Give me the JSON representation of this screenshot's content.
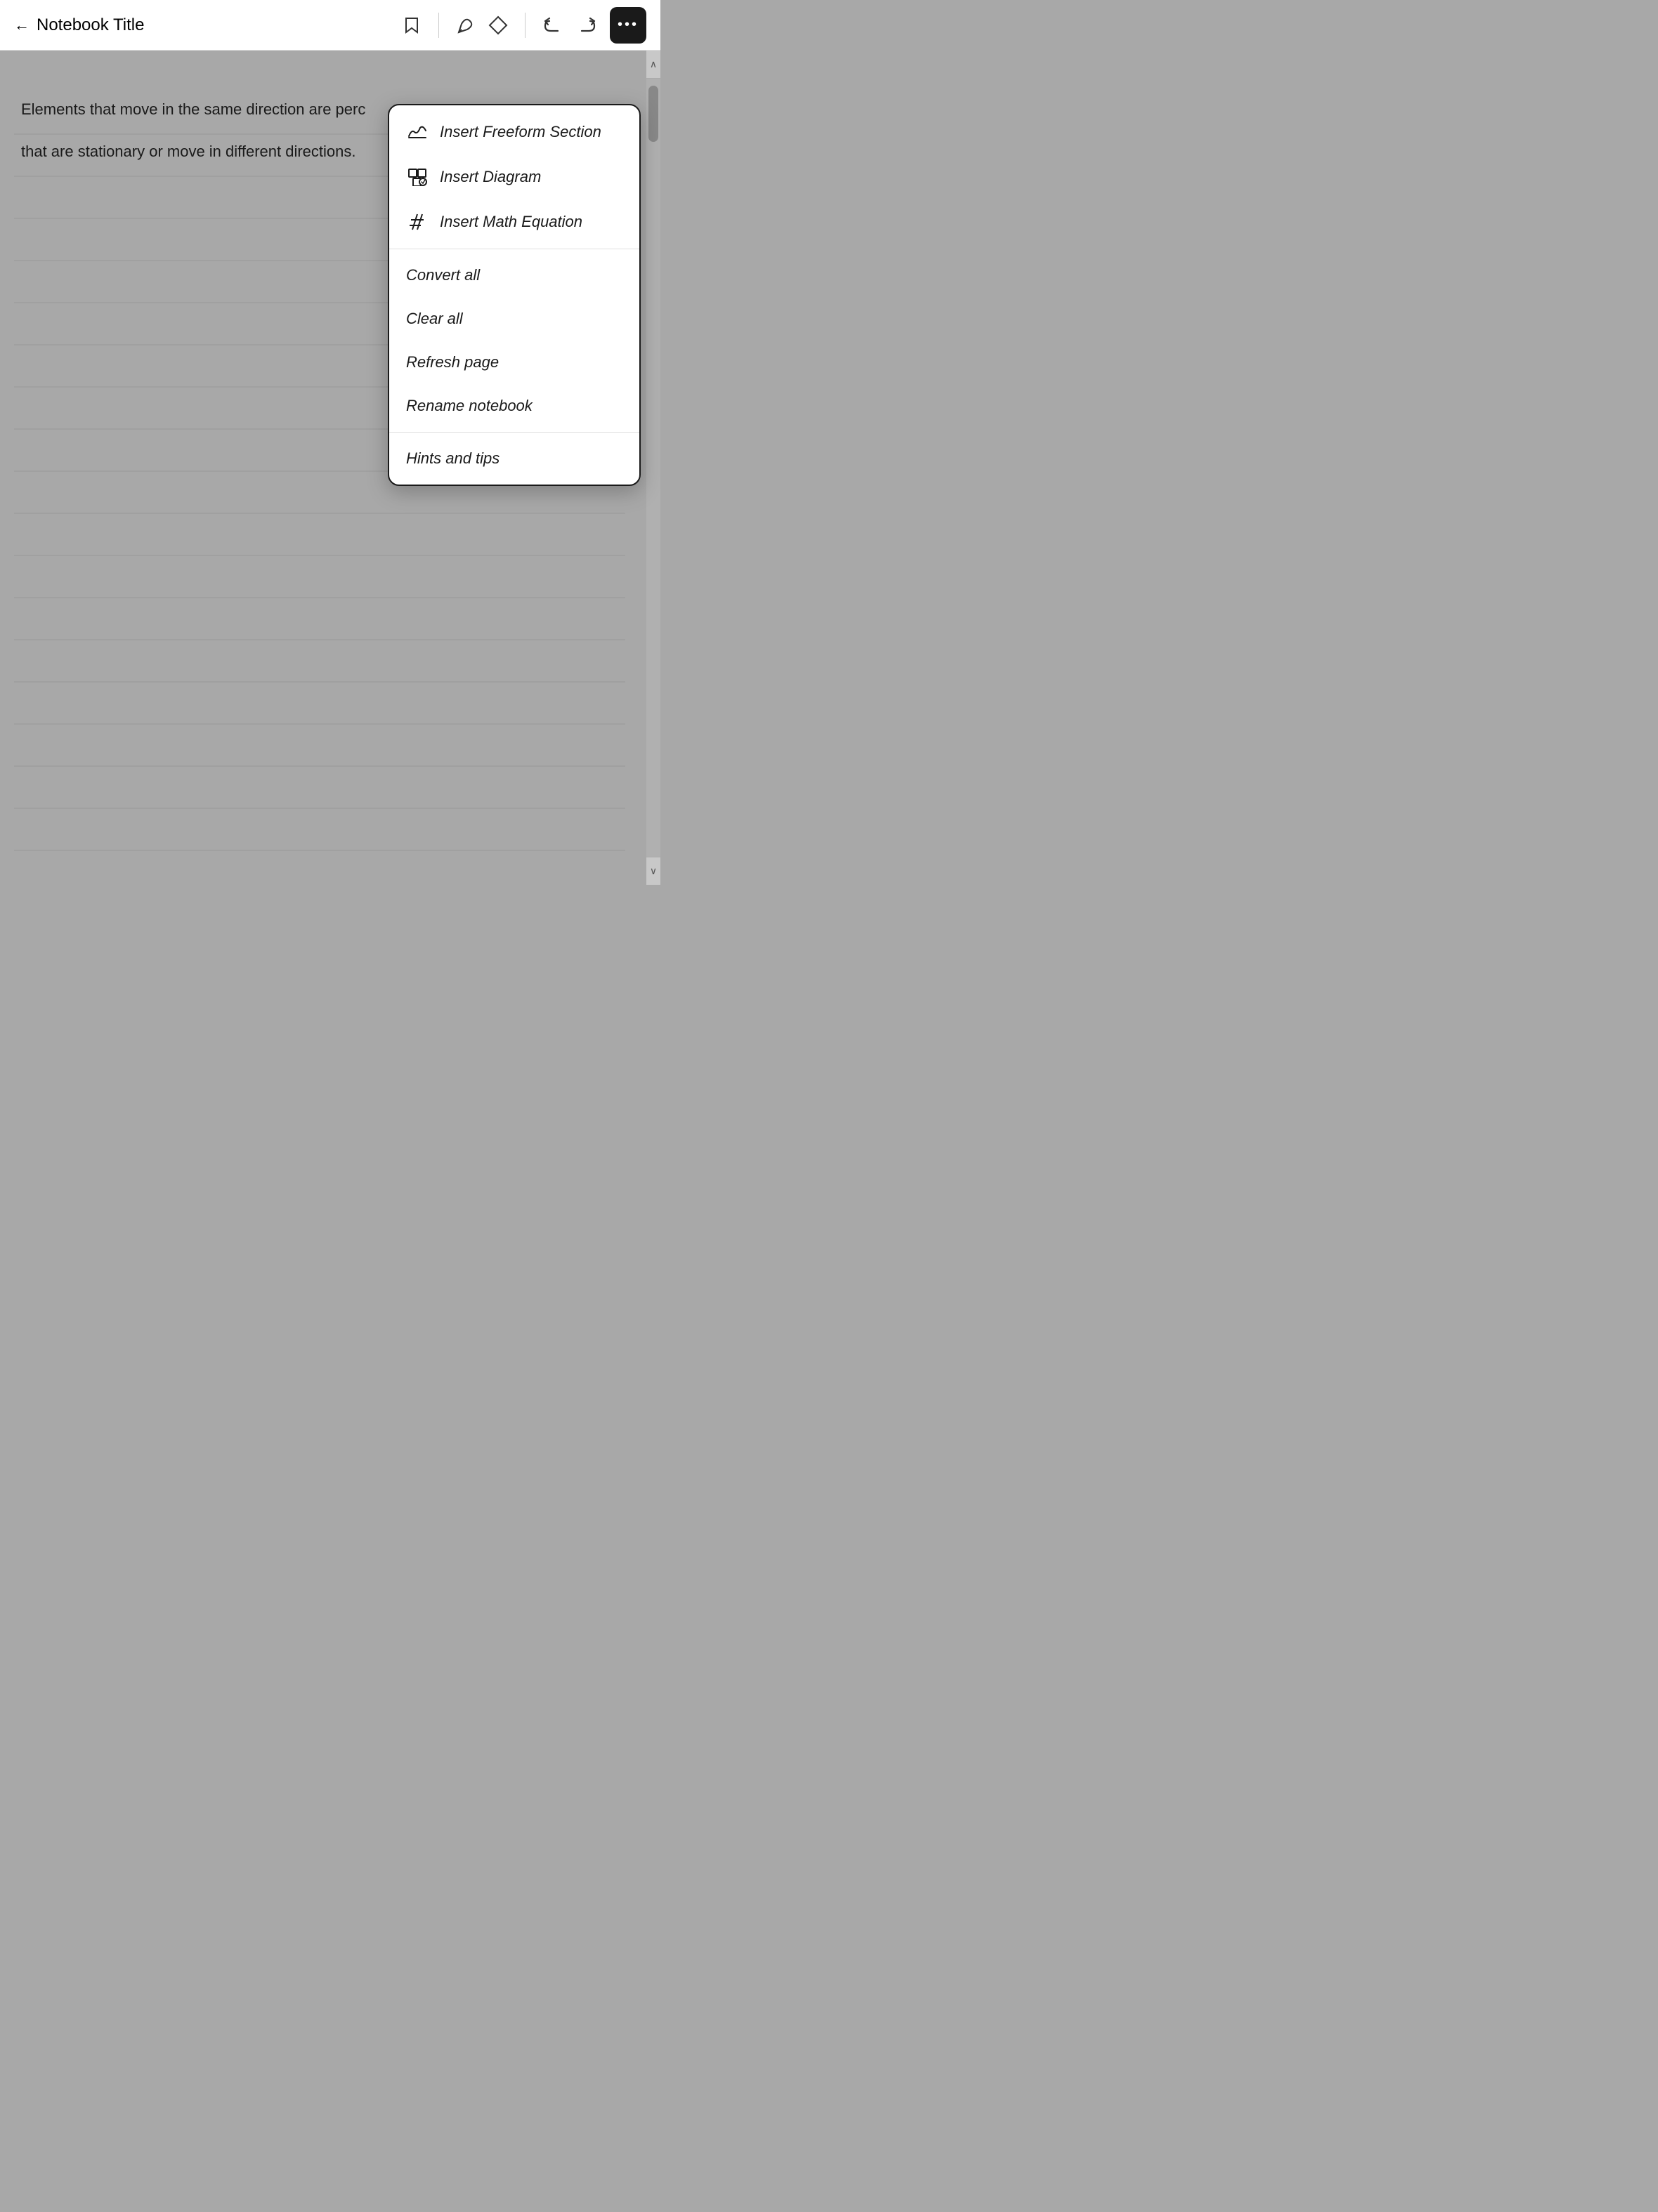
{
  "toolbar": {
    "back_label": "←",
    "title": "Notebook Title",
    "bookmark_icon": "◇",
    "pen_icon": "✒",
    "eraser_icon": "◇",
    "undo_icon": "↩",
    "redo_icon": "↪",
    "more_icon": "•••"
  },
  "content": {
    "text_line1": "Elements that move in the same direction are perc",
    "text_line2": "that are stationary or move in different directions."
  },
  "menu": {
    "insert_freeform_label": "Insert Freeform Section",
    "insert_diagram_label": "Insert Diagram",
    "insert_math_label": "Insert Math Equation",
    "convert_all_label": "Convert all",
    "clear_all_label": "Clear all",
    "refresh_page_label": "Refresh page",
    "rename_notebook_label": "Rename notebook",
    "hints_tips_label": "Hints and tips"
  },
  "scrollbar": {
    "up_icon": "∧",
    "down_icon": "∨"
  }
}
